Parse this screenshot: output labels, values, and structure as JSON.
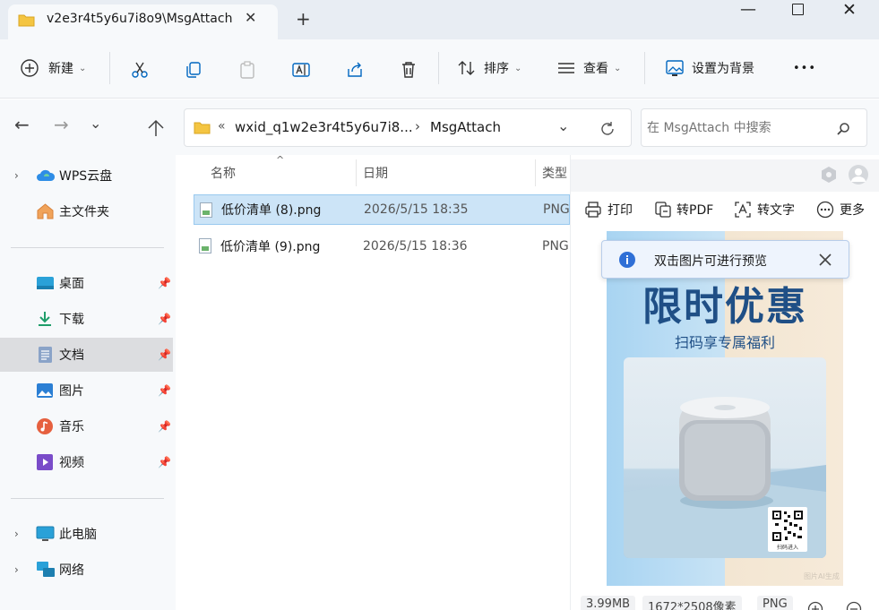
{
  "window": {
    "tab_title": "v2e3r4t5y6u7i8o9\\MsgAttach",
    "tab_close": "✕",
    "new_tab": "+",
    "minimize": "—",
    "close": "✕"
  },
  "toolbar": {
    "new_label": "新建",
    "sort_label": "排序",
    "view_label": "查看",
    "set_bg_label": "设置为背景",
    "more_label": "•••"
  },
  "nav": {
    "breadcrumb_prefix": "«",
    "breadcrumb_parent": "wxid_q1w2e3r4t5y6u7i8...",
    "breadcrumb_sep": "›",
    "breadcrumb_current": "MsgAttach",
    "search_placeholder": "在 MsgAttach 中搜索"
  },
  "sidebar": {
    "items": [
      {
        "label": "WPS云盘",
        "icon": "cloud-icon",
        "expandable": true
      },
      {
        "label": "主文件夹",
        "icon": "home-icon",
        "expandable": false
      },
      {
        "label": "桌面",
        "icon": "desktop-icon",
        "pinned": true
      },
      {
        "label": "下载",
        "icon": "download-icon",
        "pinned": true
      },
      {
        "label": "文档",
        "icon": "document-icon",
        "pinned": true,
        "selected": true
      },
      {
        "label": "图片",
        "icon": "picture-icon",
        "pinned": true
      },
      {
        "label": "音乐",
        "icon": "music-icon",
        "pinned": true
      },
      {
        "label": "视频",
        "icon": "video-icon",
        "pinned": true
      },
      {
        "label": "此电脑",
        "icon": "computer-icon",
        "expandable": true
      },
      {
        "label": "网络",
        "icon": "network-icon",
        "expandable": true
      }
    ]
  },
  "list": {
    "columns": [
      "名称",
      "日期",
      "类型"
    ],
    "rows": [
      {
        "name": "低价清单 (8).png",
        "date": "2026/5/15 18:35",
        "type": "PNG",
        "selected": true
      },
      {
        "name": "低价清单 (9).png",
        "date": "2026/5/15 18:36",
        "type": "PNG",
        "selected": false
      }
    ]
  },
  "preview": {
    "tools": {
      "print": "打印",
      "to_pdf": "转PDF",
      "to_text": "转文字",
      "more": "更多"
    },
    "toast": "双击图片可进行预览",
    "poster_title": "限时优惠",
    "poster_subtitle": "扫码享专属福利",
    "qr_caption": "扫码进入",
    "poster_footer": "图片AI生成",
    "meta": {
      "size": "3.99MB",
      "dimensions": "1672*2508像素",
      "format": "PNG"
    }
  },
  "colors": {
    "accent": "#0067c0",
    "selection": "#cce4f7",
    "poster_text": "#1f4f86"
  }
}
